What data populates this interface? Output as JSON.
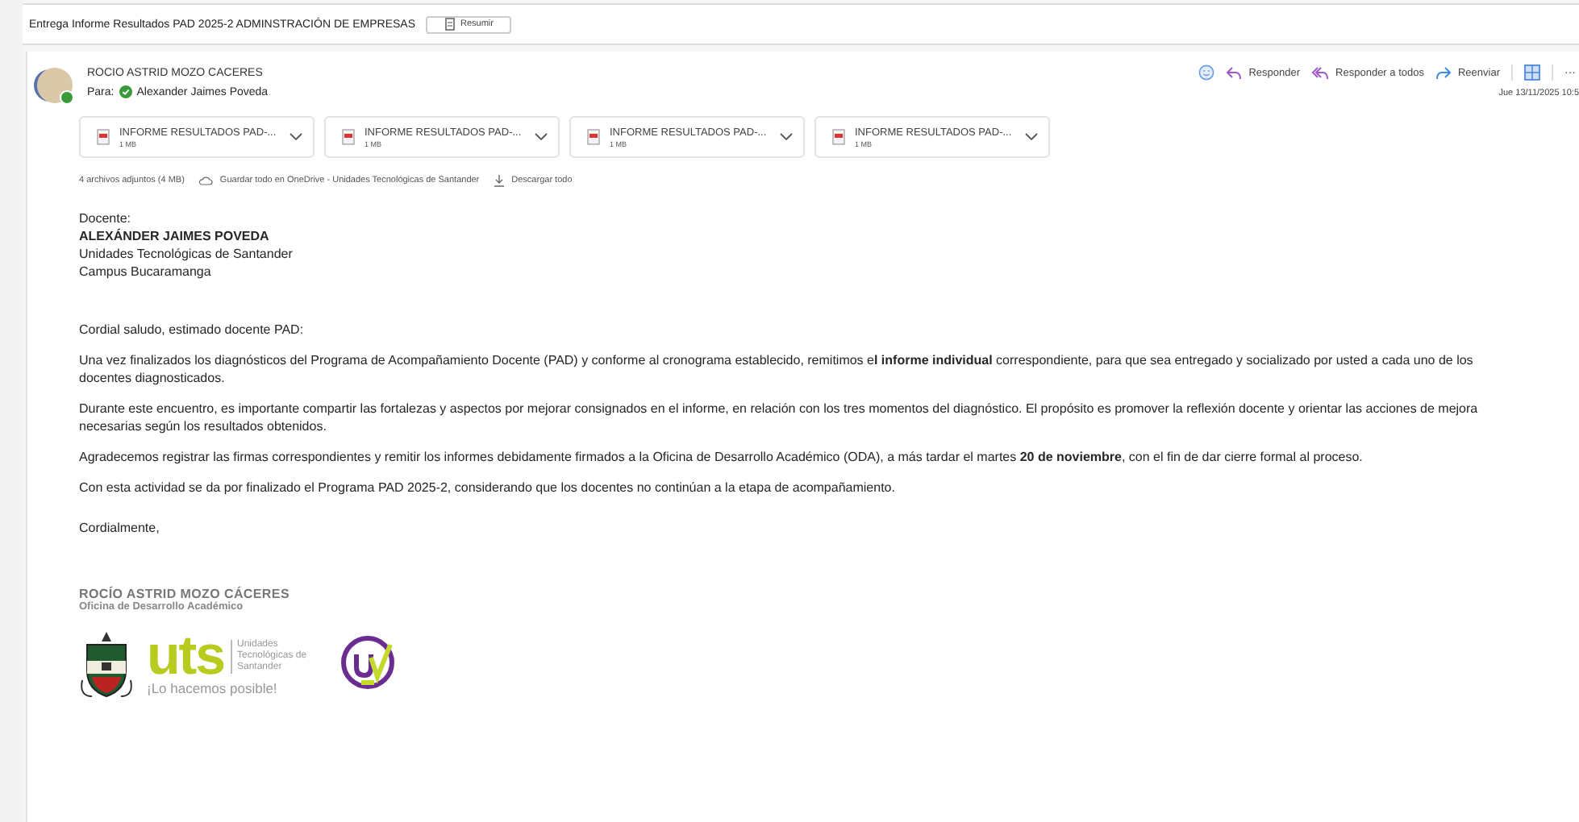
{
  "subject": {
    "title": "Entrega Informe Resultados PAD 2025-2 ADMINSTRACIÓN DE EMPRESAS",
    "summarize_button": "Resumir"
  },
  "message": {
    "sender": "ROCIO ASTRID MOZO CACERES",
    "to_label": "Para:",
    "recipient": "Alexander Jaimes Poveda",
    "date": "Jue 13/11/2025 10:5",
    "actions": [
      {
        "kind": "emoji"
      },
      {
        "kind": "reply",
        "label": "Responder"
      },
      {
        "kind": "reply_all",
        "label": "Responder a todos"
      },
      {
        "kind": "forward",
        "label": "Reenviar"
      },
      {
        "kind": "view"
      },
      {
        "kind": "more",
        "label": "···"
      }
    ]
  },
  "attachments": [
    {
      "name": "INFORME RESULTADOS PAD-...",
      "size": "1 MB"
    },
    {
      "name": "INFORME RESULTADOS PAD-...",
      "size": "1 MB"
    },
    {
      "name": "INFORME RESULTADOS PAD-...",
      "size": "1 MB"
    },
    {
      "name": "INFORME RESULTADOS PAD-...",
      "size": "1 MB"
    }
  ],
  "attachment_bar": {
    "count": "4 archivos adjuntos (4 MB)",
    "save": "Guardar todo en OneDrive - Unidades Tecnológicas de Santander",
    "download": "Descargar todo"
  },
  "body": {
    "address": [
      {
        "text": "Docente:",
        "bold": false
      },
      {
        "text": "ALEXÁNDER JAIMES POVEDA",
        "bold": true
      },
      {
        "text": "Unidades Tecnológicas de Santander",
        "bold": false
      },
      {
        "text": "Campus Bucaramanga",
        "bold": false
      }
    ],
    "paragraphs": [
      "Cordial saludo, estimado docente PAD:",
      "Una vez finalizados los diagnósticos del Programa de Acompañamiento Docente (PAD) y conforme al cronograma establecido, remitimos e**l informe individual** correspondiente, para que sea entregado y socializado por usted a cada uno de los docentes diagnosticados.",
      "Durante este encuentro, es importante compartir las fortalezas y aspectos por mejorar consignados en el informe, en relación con los tres momentos del diagnóstico. El propósito es promover la reflexión docente y orientar las acciones de mejora necesarias según los resultados obtenidos.",
      "Agradecemos registrar las firmas correspondientes y remitir los informes debidamente firmados a la Oficina de Desarrollo Académico (ODA), a más tardar el martes **20 de noviembre**, con el fin de dar cierre formal al proceso.",
      "Con esta actividad se da por finalizado el Programa PAD 2025-2, considerando que los docentes no continúan a la etapa de acompañamiento."
    ],
    "closing": "Cordialmente,"
  },
  "signature": {
    "name": "ROCÍO ASTRID MOZO CÁCERES",
    "office": "Oficina de Desarrollo Académico",
    "logo_short": "uts",
    "logo_long": "Unidades Tecnológicas de Santander",
    "slogan": "¡Lo hacemos posible!"
  }
}
